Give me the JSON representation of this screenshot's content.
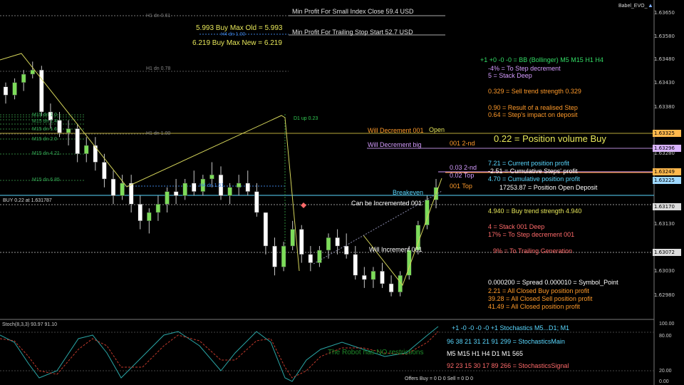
{
  "window": {
    "symbol_badge": "Babel_EVO_"
  },
  "info_top": {
    "min_profit_small": "Min Profit For Small Index Close  59.4 USD",
    "min_profit_trailing": "Min Profit For Trailing Stop Start 52.7 USD",
    "buy_max_old": "5.993 Buy Max Old = 5.993",
    "buy_max_new": "6.219 Buy Max New = 6.219"
  },
  "level_labels": {
    "h1_dn_061": "H1 dn 0.61",
    "h4_dn_100": "H4 dn 1.00",
    "h1_dn_078": "H1 dn 0.78",
    "m15_dn_1": "M15 dn 1.0",
    "m15_dn_1b": "M15 dn 1.4",
    "m15_dn_16": "M15 dn 1.6",
    "m15_dn_2": "M15 dn 2.0",
    "m15_dn_421": "M15 dn 4.21",
    "h1_dn_100": "H1 dn 1.00",
    "m15_dn_685": "M15 dn 6.85",
    "h4_dn_161": "H4 dn 1.61",
    "d1_up_023": "D1 up 0.23",
    "buy_line": "BUY 0.22 at 1.631787"
  },
  "chart_notes": {
    "will_decrement_001": "Will Decrement 001",
    "open": "Open",
    "will_decrement_big": "Will Decrement big",
    "label_001_2nd": "001 2-nd",
    "label_003_2nd": "0.03 2-nd",
    "label_002_top": "0.02 Top",
    "label_001_top": "001 Top",
    "breakeven": "Breakeven",
    "can_be_incremented": "Can be Incremented 001",
    "will_increment": "Will Increment 001"
  },
  "right_panel": {
    "bb_line": "+1 +0 -0 -0 = BB (Bollinger) M5 M15 H1 H4",
    "to_step_decrement": "-4% =  To Step decrement",
    "stack_deep": "5 =  Stack Deep",
    "sell_trend": "0.329 = Sell trend strength 0.329",
    "realised_step": "0.90 = Result of a realised Step",
    "step_impact": "0.64 = Step's impact on deposit",
    "position_volume": "0.22 = Position volume Buy",
    "current_profit": "7.21 = Current position profit",
    "cumulative_steps": "-2.51 = Cumulative Steps' profit",
    "cumulative_position": "4.70 = Cumulative position profit",
    "open_deposit": "17253.87 = Position Open Deposit",
    "buy_trend": "4.940 = Buy trend strength 4.940",
    "stack_001": "4 =  Stack 001 Deep",
    "to_step_decrement_001": "17% =  To Step decrement 001",
    "trailing_generation": "9% =  To Trailing Generation",
    "spread": "0.000200 = Spread    0.000010 = Symbol_Point",
    "closed_buy": "2.21 =  All Closed Buy position profit",
    "closed_sell": "39.28 =  All Closed Sell position profit",
    "closed_all": "41.49 =  All Closed position profit"
  },
  "price_axis": [
    "1.63650",
    "1.63580",
    "1.63480",
    "1.63430",
    "1.63380",
    "1.63325",
    "1.63296",
    "1.63280",
    "1.63249",
    "1.63225",
    "1.63170",
    "1.63130",
    "1.63072",
    "1.63030",
    "1.62980"
  ],
  "stoch_panel": {
    "title": "Stoch(8,3,3) 93.97 91.10",
    "signal_row": "+1  -0  -0  -0  -0  +1   Stochastics M5...D1; M1",
    "main_row": "96  38  21  31  21  91  299 = StochasticsMain",
    "restrictions": "The Robot has NO restrictions",
    "tf_row": "M5  M15  H1  H4  D1  M1  565",
    "signal_values": "92  23  15  30  17  89  266 = StochasticsSignal",
    "offers": "Offers Buy = 0 D 0   Sell = 0 D 0",
    "axis_top": "100.00",
    "axis_80": "80.00",
    "axis_20": "20.00",
    "axis_0": "0.00"
  },
  "colors": {
    "bull": "#7ddc5a",
    "bear": "#ffffff",
    "wick": "#c8c8c8",
    "green_text": "#33dd66",
    "orange": "#ff9a2a",
    "violet": "#d59cff",
    "cyan": "#5ad8ff",
    "yellow": "#e8e85a",
    "salmon": "#ff6a6a"
  },
  "chart_data": {
    "type": "candlestick",
    "symbol": "Babel_EVO_",
    "ylim": [
      1.6293,
      1.6367
    ],
    "note": "M5-style candles, values approximated from axis",
    "candles": [
      [
        1.6348,
        1.6349,
        1.6344,
        1.6346
      ],
      [
        1.6346,
        1.635,
        1.6345,
        1.6349
      ],
      [
        1.6349,
        1.6352,
        1.6347,
        1.6351
      ],
      [
        1.6351,
        1.6354,
        1.635,
        1.6352
      ],
      [
        1.6352,
        1.6353,
        1.6341,
        1.6342
      ],
      [
        1.6342,
        1.6344,
        1.6338,
        1.634
      ],
      [
        1.634,
        1.6342,
        1.6336,
        1.6337
      ],
      [
        1.6337,
        1.634,
        1.6334,
        1.6338
      ],
      [
        1.6338,
        1.6339,
        1.633,
        1.6332
      ],
      [
        1.6332,
        1.6336,
        1.633,
        1.6334
      ],
      [
        1.6334,
        1.6336,
        1.6328,
        1.633
      ],
      [
        1.633,
        1.6332,
        1.6324,
        1.6326
      ],
      [
        1.6326,
        1.6328,
        1.632,
        1.6322
      ],
      [
        1.6322,
        1.6327,
        1.6321,
        1.6325
      ],
      [
        1.6325,
        1.6327,
        1.6318,
        1.632
      ],
      [
        1.632,
        1.6322,
        1.6314,
        1.6316
      ],
      [
        1.6316,
        1.6319,
        1.6313,
        1.6318
      ],
      [
        1.6318,
        1.6322,
        1.6316,
        1.632
      ],
      [
        1.632,
        1.6324,
        1.6318,
        1.6323
      ],
      [
        1.6323,
        1.6326,
        1.632,
        1.6322
      ],
      [
        1.6322,
        1.6326,
        1.6321,
        1.6325
      ],
      [
        1.6325,
        1.6328,
        1.6322,
        1.6323
      ],
      [
        1.6323,
        1.6327,
        1.6322,
        1.6326
      ],
      [
        1.6326,
        1.633,
        1.6324,
        1.6327
      ],
      [
        1.6327,
        1.6329,
        1.6321,
        1.6322
      ],
      [
        1.6322,
        1.6325,
        1.632,
        1.6324
      ],
      [
        1.6324,
        1.6327,
        1.6322,
        1.6325
      ],
      [
        1.6325,
        1.6328,
        1.6322,
        1.6323
      ],
      [
        1.6323,
        1.6325,
        1.6317,
        1.6318
      ],
      [
        1.6318,
        1.6312,
        1.6308,
        1.631
      ],
      [
        1.631,
        1.6312,
        1.6303,
        1.6305
      ],
      [
        1.6305,
        1.6311,
        1.6304,
        1.631
      ],
      [
        1.631,
        1.6316,
        1.6309,
        1.6314
      ],
      [
        1.6314,
        1.6315,
        1.6306,
        1.6308
      ],
      [
        1.6308,
        1.631,
        1.6304,
        1.6306
      ],
      [
        1.6306,
        1.631,
        1.6305,
        1.6309
      ],
      [
        1.6309,
        1.6313,
        1.6307,
        1.6312
      ],
      [
        1.6312,
        1.6314,
        1.6308,
        1.631
      ],
      [
        1.631,
        1.6313,
        1.6307,
        1.6308
      ],
      [
        1.6308,
        1.631,
        1.6302,
        1.6303
      ],
      [
        1.6303,
        1.6305,
        1.63,
        1.6302
      ],
      [
        1.6302,
        1.6305,
        1.63,
        1.6304
      ],
      [
        1.6304,
        1.6306,
        1.63,
        1.6301
      ],
      [
        1.6301,
        1.6303,
        1.6298,
        1.6299
      ],
      [
        1.6299,
        1.6304,
        1.6298,
        1.6303
      ],
      [
        1.6303,
        1.631,
        1.6302,
        1.6309
      ],
      [
        1.6309,
        1.6316,
        1.6308,
        1.6315
      ],
      [
        1.6315,
        1.6322,
        1.6314,
        1.6321
      ],
      [
        1.6321,
        1.6326,
        1.6319,
        1.6324
      ]
    ]
  }
}
